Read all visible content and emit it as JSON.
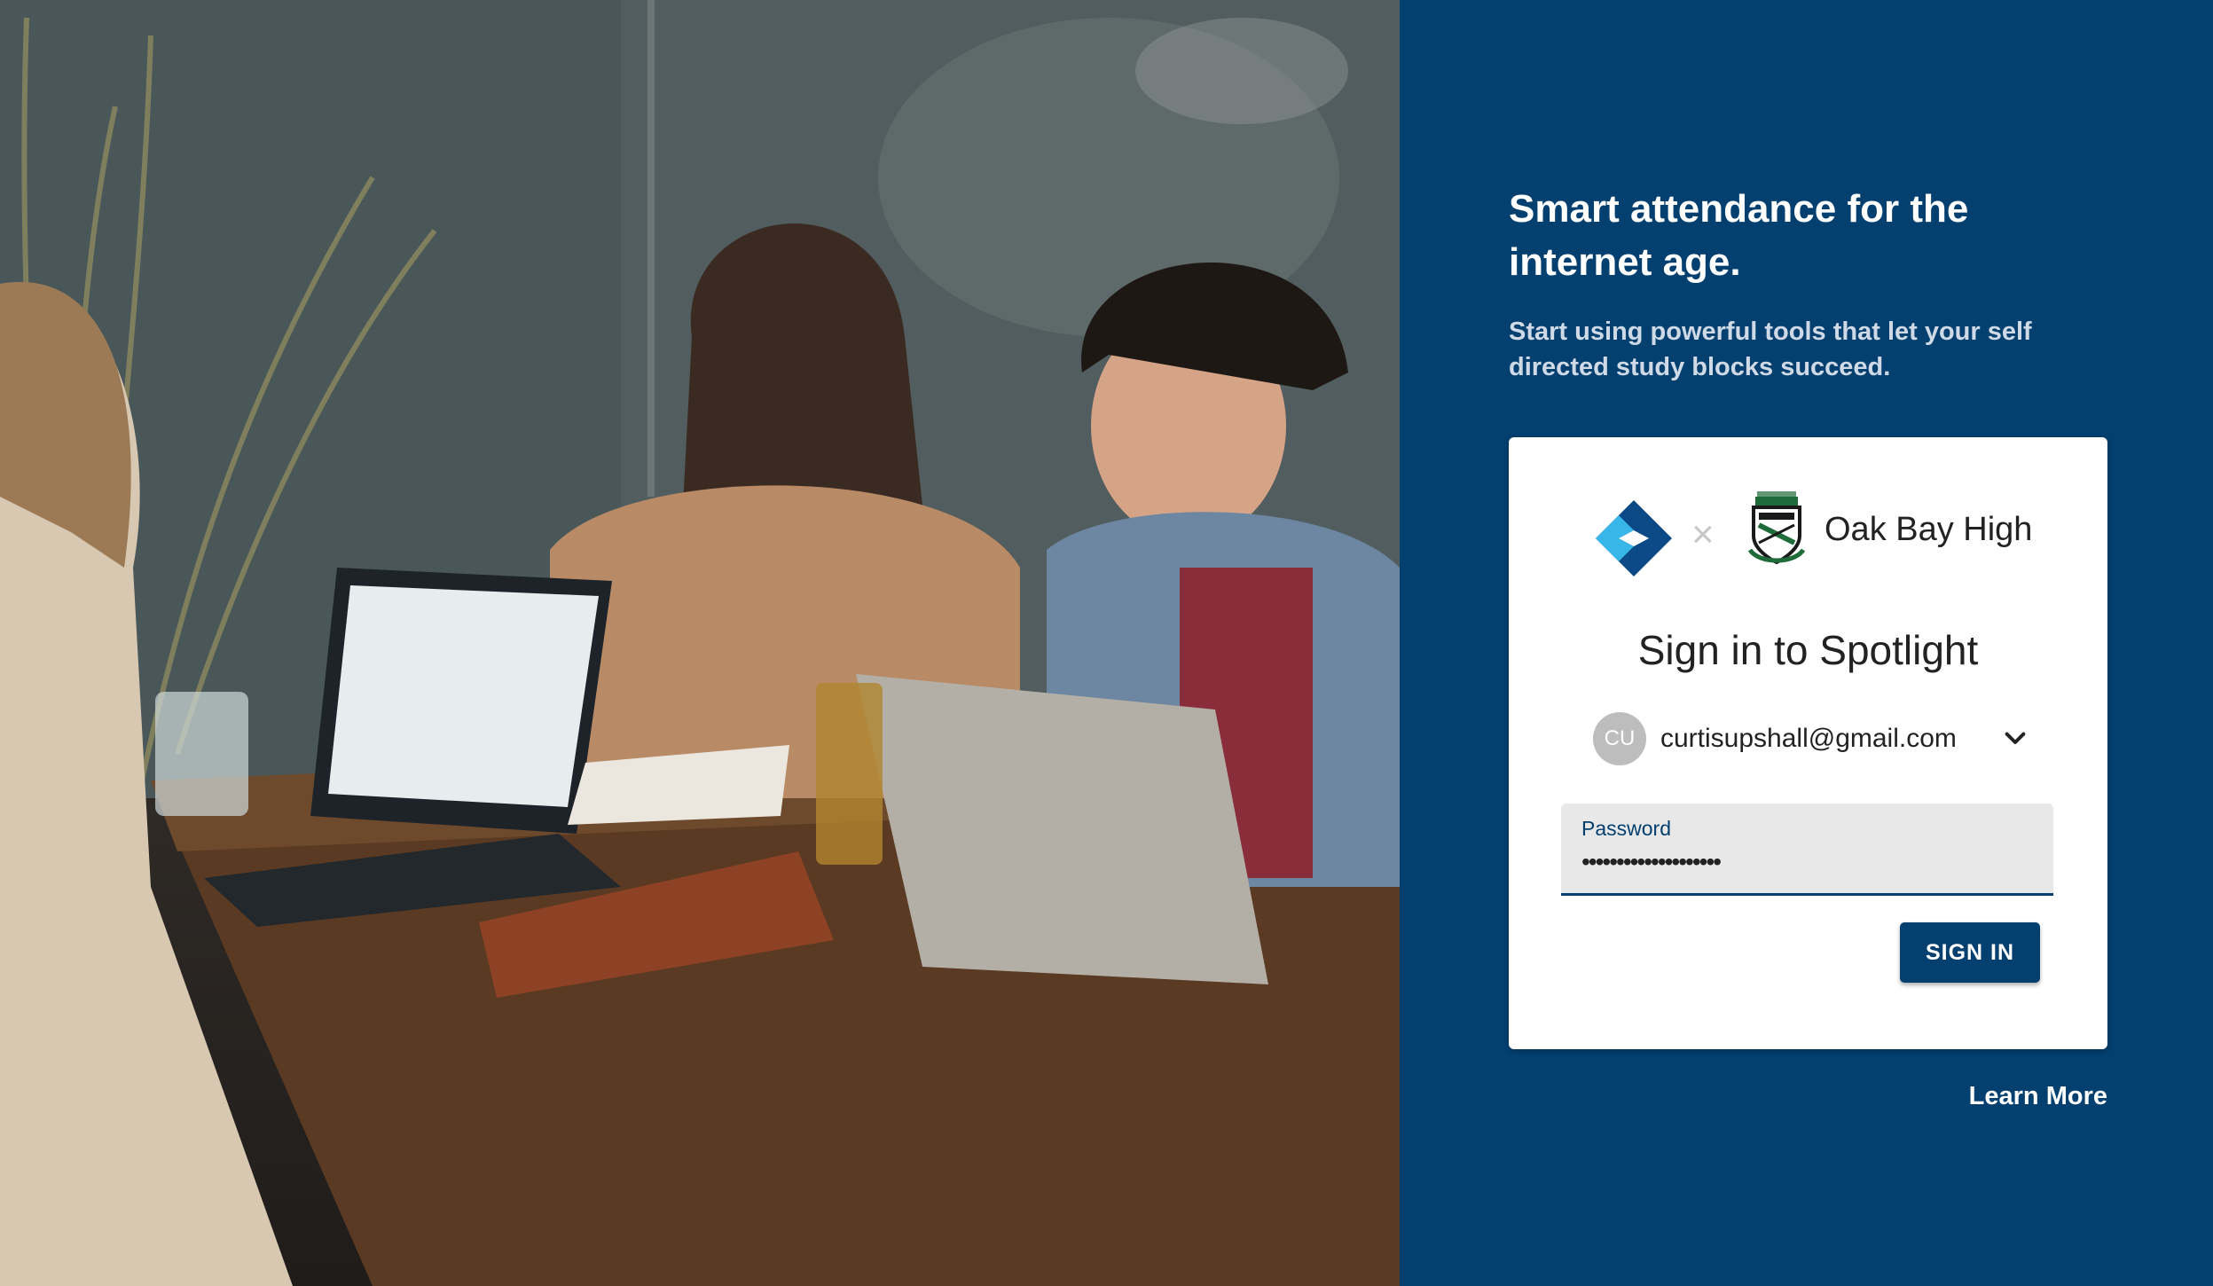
{
  "hero": {
    "headline": "Smart attendance for the internet age.",
    "subheadline": "Start using powerful tools that let your self directed study blocks succeed."
  },
  "card": {
    "separator": "×",
    "school_name": "Oak Bay High",
    "title": "Sign in to Spotlight",
    "account": {
      "initials": "CU",
      "email": "curtisupshall@gmail.com"
    },
    "password": {
      "label": "Password",
      "value": "••••••••••••••••••••"
    },
    "signin_label": "SIGN IN"
  },
  "footer": {
    "learn_more": "Learn More"
  },
  "colors": {
    "brand_blue": "#033f6f",
    "logo_light": "#38b6e8",
    "logo_dark": "#0b4a86"
  }
}
